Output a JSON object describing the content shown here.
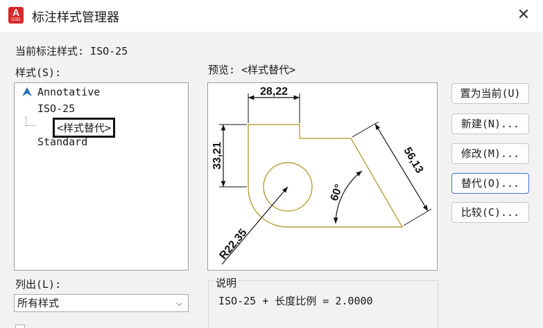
{
  "window": {
    "title": "标注样式管理器",
    "app_icon_letter": "A",
    "app_icon_caption": "CAD",
    "close_glyph": "✕"
  },
  "current_style": "当前标注样式: ISO-25",
  "styles_label": "样式(S):",
  "styles": [
    {
      "label": "Annotative",
      "icon": "annotative-icon"
    },
    {
      "label": "ISO-25"
    },
    {
      "label": "<样式替代>",
      "highlighted": true
    },
    {
      "label": "Standard"
    }
  ],
  "preview_label": "预览: <样式替代>",
  "preview": {
    "dim_top": "28,22",
    "dim_left": "33,21",
    "dim_right": "56,13",
    "dim_angle": "60°",
    "dim_radius": "R22,35"
  },
  "buttons": {
    "set_current": "置为当前(U)",
    "new": "新建(N)...",
    "modify": "修改(M)...",
    "override": "替代(O)...",
    "compare": "比较(C)..."
  },
  "list_out_label": "列出(L):",
  "list_select_value": "所有样式",
  "description_label": "说明",
  "description_text": "ISO-25 + 长度比例 = 2.0000",
  "colors": {
    "geometry": "#a8901c",
    "dimension": "#111111",
    "active_border": "#3c6fd8",
    "app_icon": "#d62b2b"
  }
}
